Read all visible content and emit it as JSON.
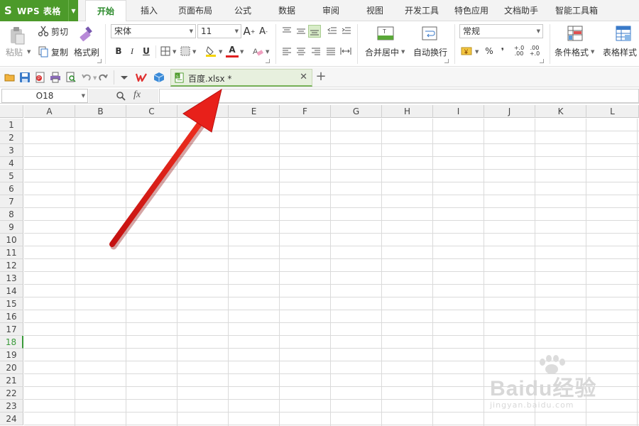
{
  "app": {
    "logo_char": "S",
    "name": "WPS 表格"
  },
  "menu": {
    "tabs": [
      "开始",
      "插入",
      "页面布局",
      "公式",
      "数据",
      "审阅",
      "视图",
      "开发工具",
      "特色应用",
      "文档助手",
      "智能工具箱"
    ],
    "active": "开始"
  },
  "ribbon": {
    "paste": "粘贴",
    "cut": "剪切",
    "copy": "复制",
    "format_painter": "格式刷",
    "font_name": "宋体",
    "font_size": "11",
    "bold": "B",
    "italic": "I",
    "underline": "U",
    "merge_center": "合并居中",
    "wrap_text": "自动换行",
    "number_format": "常规",
    "percent": "%",
    "thousands": "❜",
    "conditional_format": "条件格式",
    "table_style": "表格样式"
  },
  "document": {
    "tab_title": "百度.xlsx *"
  },
  "formula_bar": {
    "name_box": "O18",
    "fx": "fx",
    "formula": ""
  },
  "sheet": {
    "columns": [
      "A",
      "B",
      "C",
      "D",
      "E",
      "F",
      "G",
      "H",
      "I",
      "J",
      "K",
      "L"
    ],
    "rows": [
      "1",
      "2",
      "3",
      "4",
      "5",
      "6",
      "7",
      "8",
      "9",
      "10",
      "11",
      "12",
      "13",
      "14",
      "15",
      "16",
      "17",
      "18",
      "19",
      "20",
      "21",
      "22",
      "23",
      "24"
    ],
    "active_row": "18"
  },
  "watermark": {
    "main": "Baidu经验",
    "sub": "jingyan.baidu.com"
  },
  "colors": {
    "brand_green": "#4c9a2a",
    "active_tab_text": "#2a8a2a",
    "annotation_arrow": "#e8201a"
  }
}
